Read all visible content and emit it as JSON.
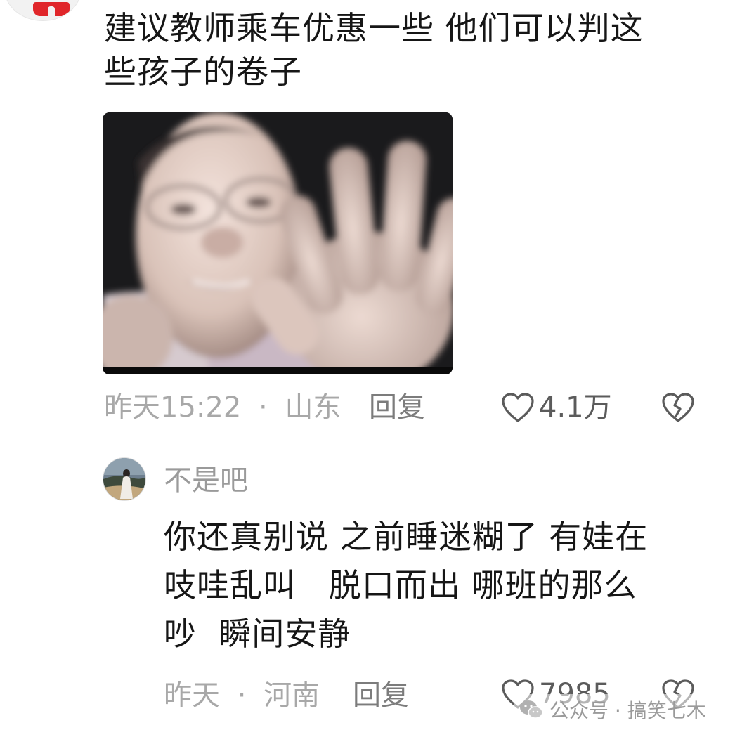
{
  "comment1": {
    "text_line1": "建议教师乘车优惠一些 他们可以判这",
    "text_line2": "些孩子的卷子",
    "time": "昨天15:22",
    "separator": "·",
    "location": "山东",
    "reply_label": "回复",
    "like_count": "4.1万"
  },
  "reply1": {
    "username": "不是吧",
    "text_line1": "你还真别说 之前睡迷糊了 有娃在",
    "text_line2": "吱哇乱叫   脱口而出 哪班的那么",
    "text_line3": "吵  瞬间安静",
    "time": "昨天",
    "separator": "·",
    "location": "河南",
    "reply_label": "回复",
    "like_count": "7985"
  },
  "watermark": {
    "icon": "wechat-icon",
    "text": "公众号 · 搞笑七木"
  },
  "colors": {
    "text": "#161616",
    "meta": "#a8a8a8",
    "reply": "#7c7c7c",
    "accent_red": "#e0262a"
  }
}
